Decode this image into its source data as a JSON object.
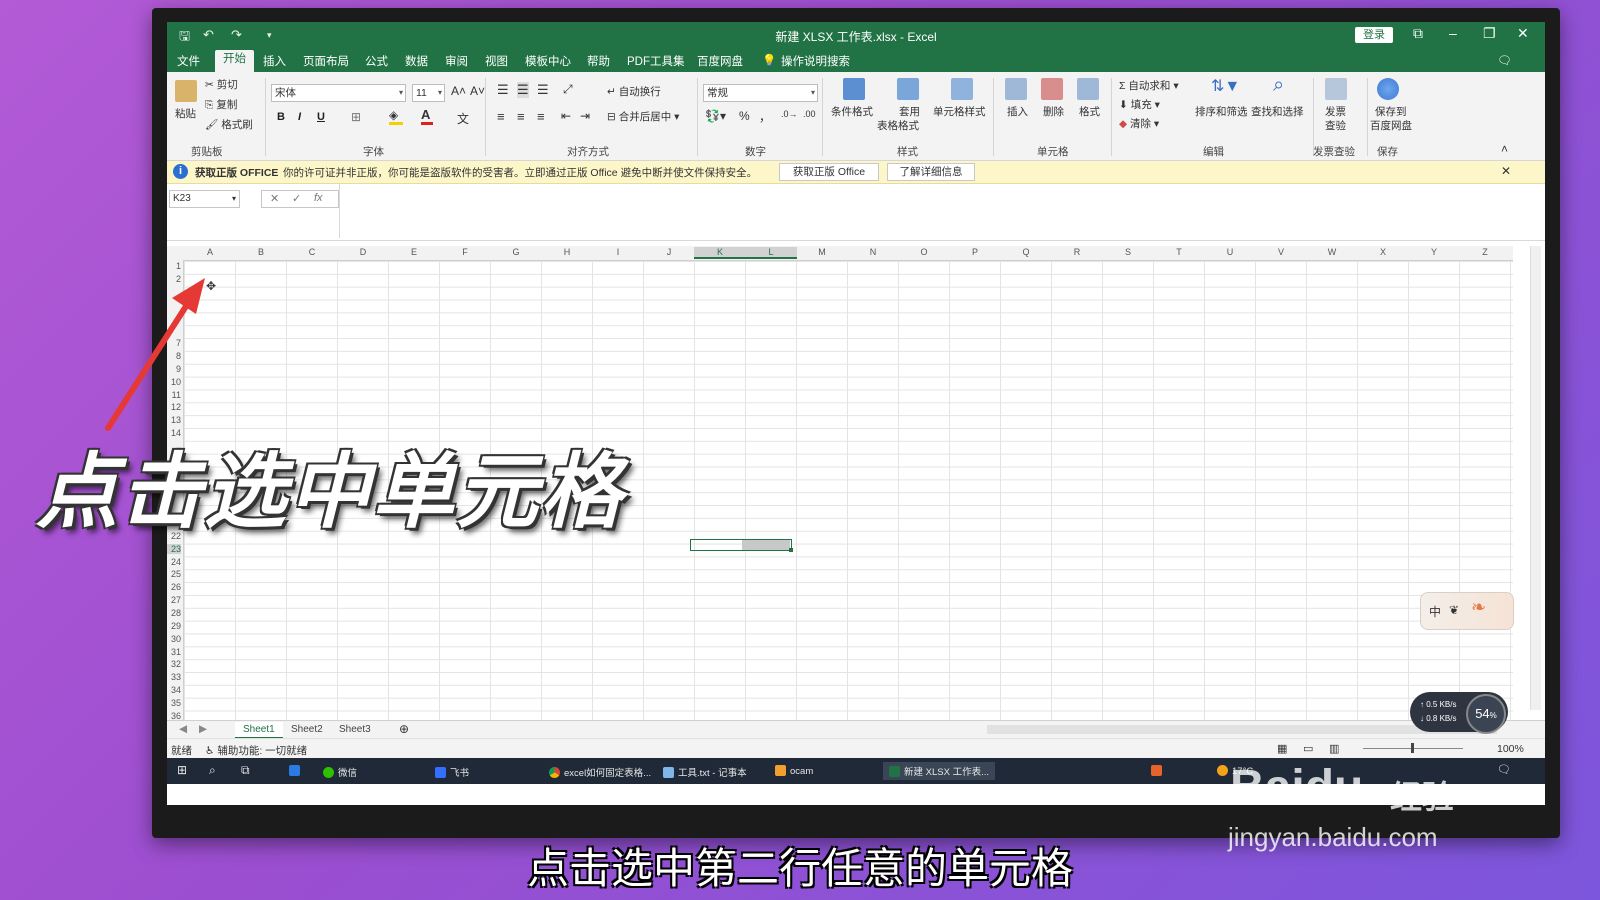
{
  "window": {
    "title": "新建 XLSX 工作表.xlsx  -  Excel",
    "login_label": "登录"
  },
  "menu": {
    "tabs": [
      "文件",
      "开始",
      "插入",
      "页面布局",
      "公式",
      "数据",
      "审阅",
      "视图",
      "模板中心",
      "帮助",
      "PDF工具集",
      "百度网盘"
    ],
    "search_label": "操作说明搜索"
  },
  "ribbon": {
    "clipboard": {
      "paste": "粘贴",
      "cut": "剪切",
      "copy": "复制",
      "format_painter": "格式刷",
      "group": "剪贴板"
    },
    "font": {
      "name": "宋体",
      "size": "11",
      "bold": "B",
      "italic": "I",
      "underline": "U",
      "group": "字体"
    },
    "alignment": {
      "wrap": "自动换行",
      "merge": "合并后居中",
      "group": "对齐方式"
    },
    "number": {
      "format": "常规",
      "percent": "%",
      "comma": "，",
      "group": "数字"
    },
    "styles": {
      "conditional": "条件格式",
      "table_format_1": "套用",
      "table_format_2": "表格格式",
      "cell_styles": "单元格样式",
      "group": "样式"
    },
    "cells": {
      "insert": "插入",
      "delete": "删除",
      "format": "格式",
      "group": "单元格"
    },
    "editing": {
      "autosum": "自动求和",
      "fill": "填充",
      "clear": "清除",
      "sort_filter": "排序和筛选",
      "find_select": "查找和选择",
      "group": "编辑"
    },
    "invoice": {
      "check_1": "发票",
      "check_2": "查验",
      "group": "发票查验"
    },
    "save": {
      "save_1": "保存到",
      "save_2": "百度网盘",
      "group": "保存"
    }
  },
  "infobar": {
    "title": "获取正版 OFFICE",
    "message": "你的许可证并非正版，你可能是盗版软件的受害者。立即通过正版 Office 避免中断并使文件保持安全。",
    "btn_get": "获取正版 Office",
    "btn_learn": "了解详细信息"
  },
  "formula_bar": {
    "name_box": "K23",
    "fx": "fx"
  },
  "grid": {
    "columns": [
      "A",
      "B",
      "C",
      "D",
      "E",
      "F",
      "G",
      "H",
      "I",
      "J",
      "K",
      "L",
      "M",
      "N",
      "O",
      "P",
      "Q",
      "R",
      "S",
      "T",
      "U",
      "V",
      "W",
      "X",
      "Y",
      "Z"
    ],
    "rows": [
      "1",
      "2",
      "",
      "",
      "",
      "",
      "7",
      "8",
      "9",
      "10",
      "11",
      "12",
      "13",
      "14",
      "",
      "",
      "",
      "",
      "",
      "",
      "21",
      "22",
      "23",
      "24",
      "25",
      "26",
      "27",
      "28",
      "29",
      "30",
      "31",
      "32",
      "33",
      "34",
      "35",
      "36"
    ]
  },
  "sheets": [
    "Sheet1",
    "Sheet2",
    "Sheet3"
  ],
  "statusbar": {
    "ready": "就绪",
    "accessibility": "辅助功能: 一切就绪",
    "zoom": "100%"
  },
  "taskbar": {
    "items": [
      "微信",
      "飞书",
      "excel如何固定表格...",
      "工具.txt - 记事本",
      "ocam",
      "新建 XLSX 工作表..."
    ],
    "weather": "17°C"
  },
  "widgets": {
    "speed_up": "0.5",
    "speed_down": "0.8",
    "speed_unit": "KB/s",
    "speed_percent": "54",
    "ime": "中"
  },
  "overlay": {
    "annotation": "点击选中单元格",
    "subtitle": "点击选中第二行任意的单元格",
    "watermark_brand": "Baidu",
    "watermark_jy": "经验",
    "watermark_url": "jingyan.baidu.com"
  },
  "colors": {
    "excel_green": "#217346",
    "arrow_red": "#e53935"
  }
}
